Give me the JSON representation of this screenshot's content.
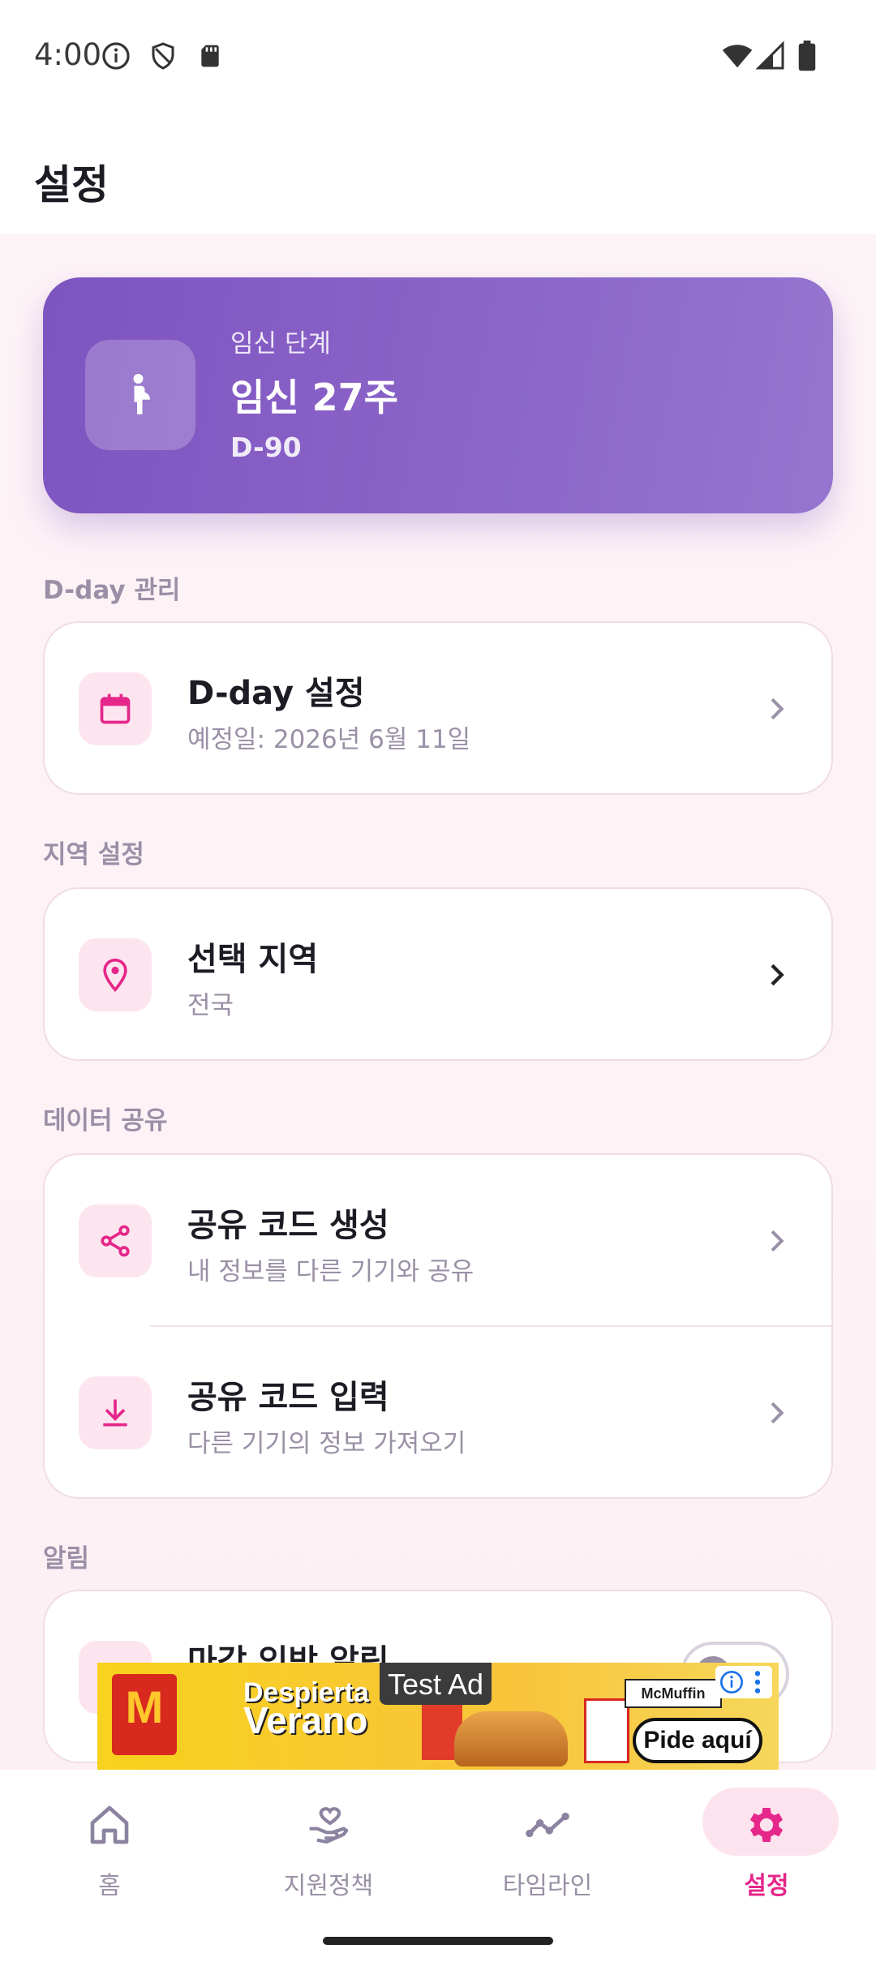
{
  "status_bar": {
    "time": "4:00"
  },
  "page": {
    "title": "설정"
  },
  "pregnancy_card": {
    "label": "임신 단계",
    "week": "임신 27주",
    "dday": "D-90"
  },
  "sections": {
    "dday": {
      "header": "D-day 관리",
      "item": {
        "title": "D-day 설정",
        "subtitle": "예정일: 2026년 6월 11일"
      }
    },
    "region": {
      "header": "지역 설정",
      "item": {
        "title": "선택 지역",
        "subtitle": "전국"
      }
    },
    "share": {
      "header": "데이터 공유",
      "items": [
        {
          "title": "공유 코드 생성",
          "subtitle": "내 정보를 다른 기기와 공유"
        },
        {
          "title": "공유 코드 입력",
          "subtitle": "다른 기기의 정보 가져오기"
        }
      ]
    },
    "notifications": {
      "header": "알림",
      "item": {
        "title": "마감 임박 알림"
      }
    }
  },
  "ad": {
    "test_label": "Test Ad",
    "headline_1": "Despierta",
    "headline_2": "Verano",
    "product": "McMuffin",
    "cta": "Pide aquí",
    "brand_glyph": "M"
  },
  "bottom_nav": {
    "items": [
      {
        "label": "홈",
        "icon": "home-icon"
      },
      {
        "label": "지원정책",
        "icon": "hand-heart-icon"
      },
      {
        "label": "타임라인",
        "icon": "timeline-icon"
      },
      {
        "label": "설정",
        "icon": "settings-icon",
        "selected": true
      }
    ]
  },
  "colors": {
    "accent_pink": "#e5268a",
    "hero_purple": "#8a63c8",
    "icon_bg": "#fde5ef"
  }
}
